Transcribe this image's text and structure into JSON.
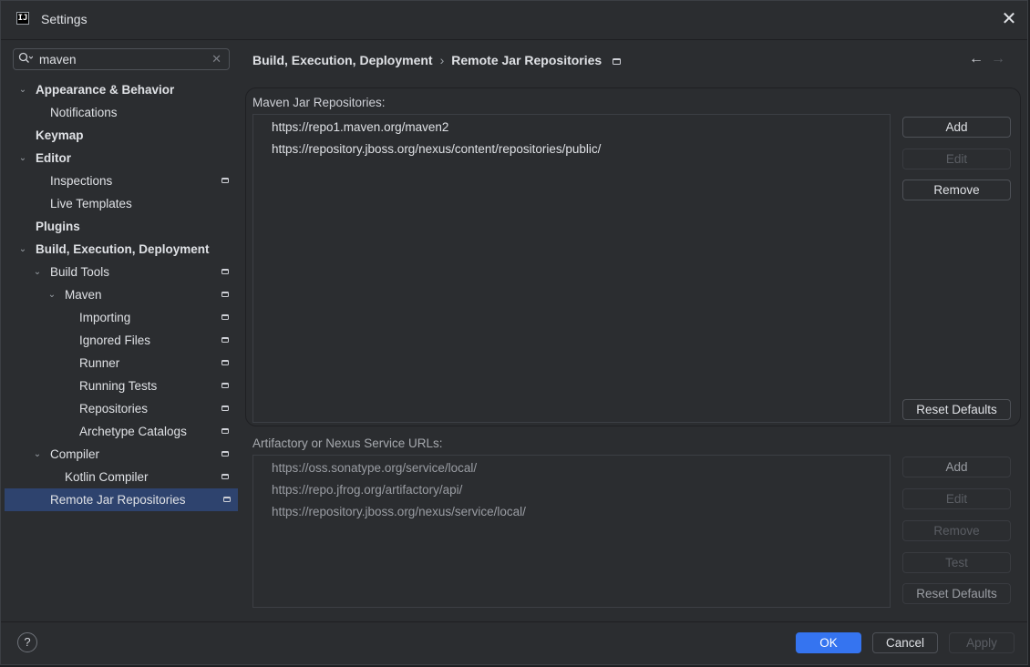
{
  "window": {
    "title": "Settings"
  },
  "search": {
    "value": "maven",
    "placeholder": ""
  },
  "tree": [
    {
      "label": "Appearance & Behavior",
      "bold": true,
      "level": 0,
      "expanded": true,
      "project": false
    },
    {
      "label": "Notifications",
      "bold": false,
      "level": 1,
      "leaf": true,
      "project": false
    },
    {
      "label": "Keymap",
      "bold": true,
      "level": 0,
      "leaf": true,
      "project": false
    },
    {
      "label": "Editor",
      "bold": true,
      "level": 0,
      "expanded": true,
      "project": false
    },
    {
      "label": "Inspections",
      "bold": false,
      "level": 1,
      "leaf": true,
      "project": true
    },
    {
      "label": "Live Templates",
      "bold": false,
      "level": 1,
      "leaf": true,
      "project": false
    },
    {
      "label": "Plugins",
      "bold": true,
      "level": 0,
      "leaf": true,
      "project": false
    },
    {
      "label": "Build, Execution, Deployment",
      "bold": true,
      "level": 0,
      "expanded": true,
      "project": false
    },
    {
      "label": "Build Tools",
      "bold": false,
      "level": 1,
      "expanded": true,
      "project": true
    },
    {
      "label": "Maven",
      "bold": false,
      "level": 2,
      "expanded": true,
      "project": true
    },
    {
      "label": "Importing",
      "bold": false,
      "level": 3,
      "leaf": true,
      "project": true
    },
    {
      "label": "Ignored Files",
      "bold": false,
      "level": 3,
      "leaf": true,
      "project": true
    },
    {
      "label": "Runner",
      "bold": false,
      "level": 3,
      "leaf": true,
      "project": true
    },
    {
      "label": "Running Tests",
      "bold": false,
      "level": 3,
      "leaf": true,
      "project": true
    },
    {
      "label": "Repositories",
      "bold": false,
      "level": 3,
      "leaf": true,
      "project": true
    },
    {
      "label": "Archetype Catalogs",
      "bold": false,
      "level": 3,
      "leaf": true,
      "project": true
    },
    {
      "label": "Compiler",
      "bold": false,
      "level": 1,
      "expanded": true,
      "project": true
    },
    {
      "label": "Kotlin Compiler",
      "bold": false,
      "level": 2,
      "leaf": true,
      "project": true
    },
    {
      "label": "Remote Jar Repositories",
      "bold": false,
      "level": 1,
      "leaf": true,
      "project": true,
      "selected": true
    }
  ],
  "breadcrumb": {
    "parent": "Build, Execution, Deployment",
    "separator": "›",
    "current": "Remote Jar Repositories"
  },
  "nav": {
    "back": "←",
    "forward": "→"
  },
  "maven_section": {
    "label": "Maven Jar Repositories:",
    "items": [
      "https://repo1.maven.org/maven2",
      "https://repository.jboss.org/nexus/content/repositories/public/"
    ],
    "buttons": {
      "add": "Add",
      "edit": "Edit",
      "remove": "Remove",
      "reset": "Reset Defaults"
    }
  },
  "artifactory_section": {
    "label": "Artifactory or Nexus Service URLs:",
    "items": [
      "https://oss.sonatype.org/service/local/",
      "https://repo.jfrog.org/artifactory/api/",
      "https://repository.jboss.org/nexus/service/local/"
    ],
    "buttons": {
      "add": "Add",
      "edit": "Edit",
      "remove": "Remove",
      "test": "Test",
      "reset": "Reset Defaults"
    }
  },
  "footer": {
    "help": "?",
    "ok": "OK",
    "cancel": "Cancel",
    "apply": "Apply"
  },
  "icons": {
    "app": "intellij-app-icon",
    "search": "search-icon",
    "clear": "clear-icon",
    "close": "close-icon",
    "chevron": "chevron-down-icon",
    "project_scope": "project-scope-icon"
  },
  "colors": {
    "accent": "#3574f0",
    "selection": "#2e436e",
    "background": "#2b2d30"
  }
}
